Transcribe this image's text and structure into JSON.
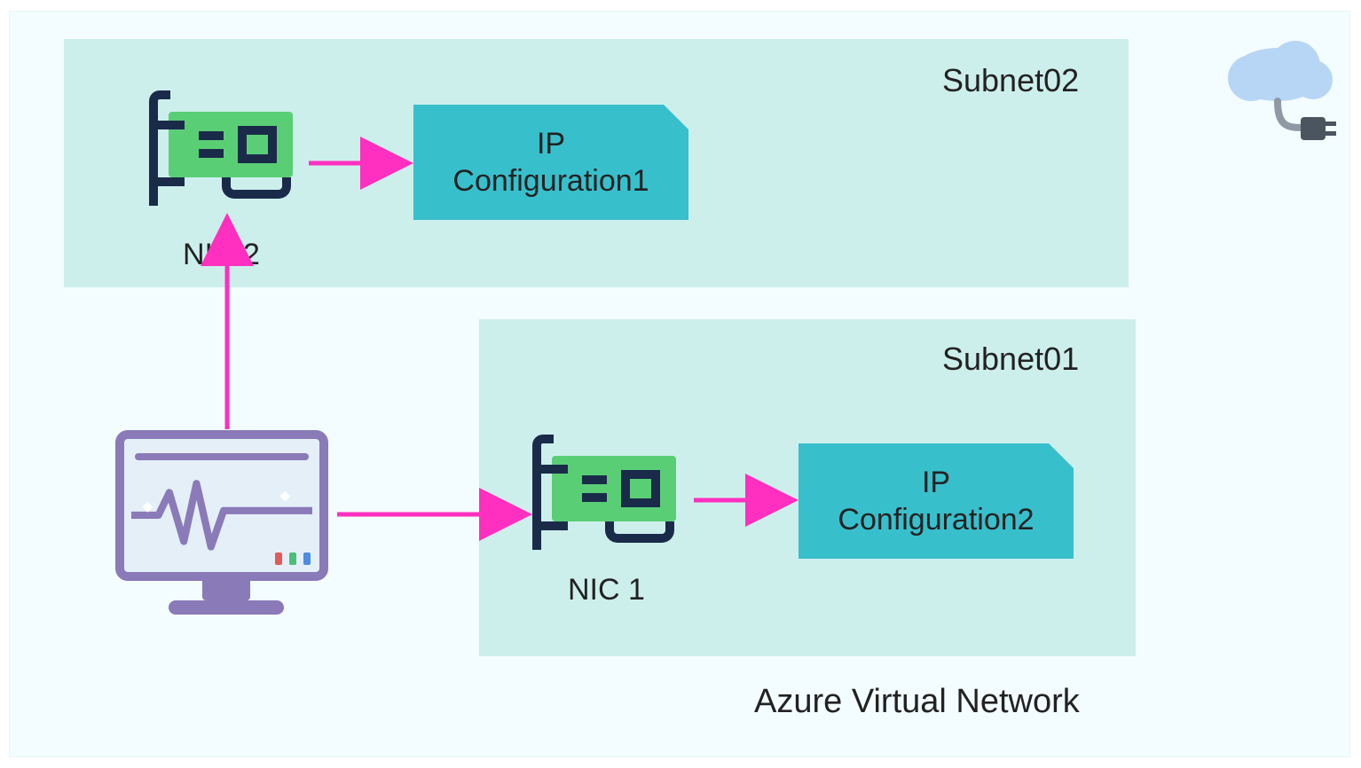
{
  "diagram": {
    "outer_region": "Azure Virtual Network region",
    "subnets": {
      "top": {
        "name": "Subnet02"
      },
      "bottom": {
        "name": "Subnet01"
      }
    },
    "nics": {
      "nic2": {
        "label": "NIC 2"
      },
      "nic1": {
        "label": "NIC 1"
      }
    },
    "ip_configs": {
      "cfg1": {
        "line1": "IP",
        "line2": "Configuration1"
      },
      "cfg2": {
        "line1": "IP",
        "line2": "Configuration2"
      }
    },
    "vnet_label": "Azure Virtual Network",
    "icons": {
      "monitor": "monitor-vm",
      "cloudplug": "cloud-plug",
      "nic": "network-interface-card"
    },
    "arrows": [
      {
        "id": "monitor-to-nic2",
        "from": "monitor",
        "to": "NIC 2",
        "color": "#ff2fbf"
      },
      {
        "id": "nic2-to-ipcfg1",
        "from": "NIC 2",
        "to": "IP Configuration1",
        "color": "#ff2fbf"
      },
      {
        "id": "monitor-to-nic1",
        "from": "monitor",
        "to": "NIC 1",
        "color": "#ff2fbf"
      },
      {
        "id": "nic1-to-ipcfg2",
        "from": "NIC 1",
        "to": "IP Configuration2",
        "color": "#ff2fbf"
      }
    ],
    "colors": {
      "subnet_bg": "#cdefec",
      "outer_bg": "#f3fcfe",
      "ip_box_bg": "#38bfcc",
      "nic_green": "#5ace75",
      "nic_stroke": "#1a2b4a",
      "arrow": "#ff2fbf",
      "monitor_frame": "#8a7ab8",
      "cloud": "#b7d6f5",
      "plug": "#4a5560"
    }
  }
}
